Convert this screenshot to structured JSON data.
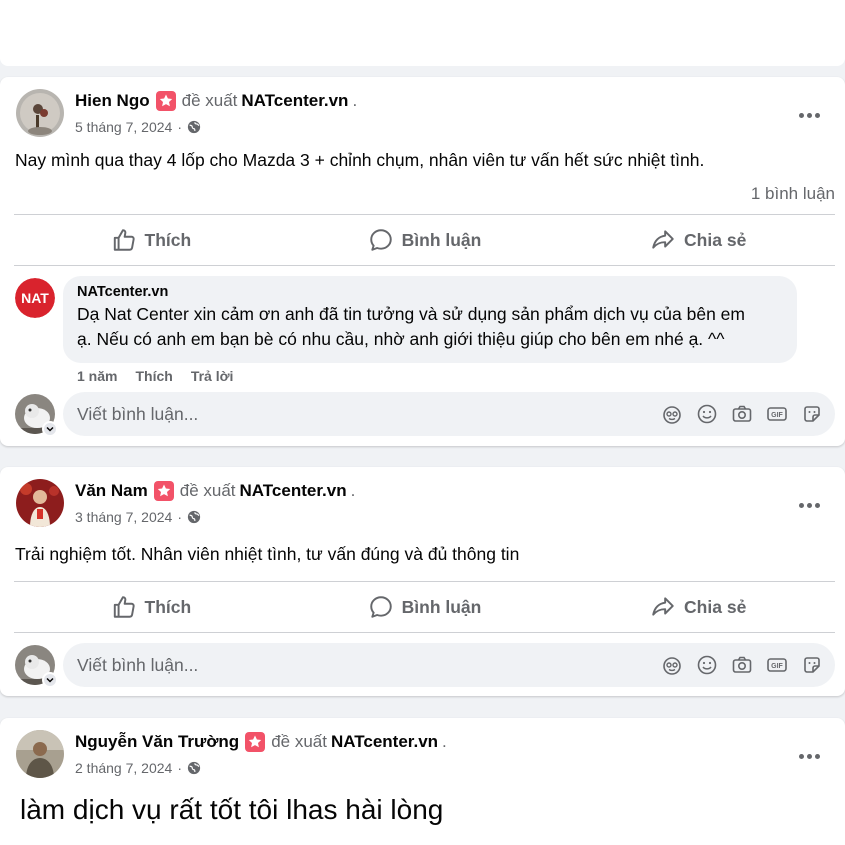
{
  "posts": [
    {
      "author": "Hien Ngo",
      "recommend_text": "đề xuất",
      "page": "NATcenter.vn",
      "date": "5 tháng 7, 2024",
      "separator": "·",
      "text": "Nay mình qua thay 4 lốp cho Mazda 3 + chỉnh chụm, nhân viên tư vấn hết sức nhiệt tình.",
      "comment_count": "1 bình luận",
      "comment": {
        "author": "NATcenter.vn",
        "avatar_text": "NAT",
        "body_line1": "Dạ Nat Center xin cảm ơn anh đã tin tưởng và sử dụng sản phẩm dịch vụ của bên em",
        "body_line2": "ạ. Nếu có anh em bạn bè có nhu cầu, nhờ anh giới thiệu giúp cho bên em nhé ạ. ^^",
        "time": "1 năm",
        "like": "Thích",
        "reply": "Trả lời"
      }
    },
    {
      "author": "Văn Nam",
      "recommend_text": "đề xuất",
      "page": "NATcenter.vn",
      "date": "3 tháng 7, 2024",
      "separator": "·",
      "text": "Trải nghiệm tốt. Nhân viên nhiệt tình, tư vấn đúng và đủ thông tin"
    },
    {
      "author": "Nguyễn Văn Trường",
      "recommend_text": "đề xuất",
      "page": "NATcenter.vn",
      "date": "2 tháng 7, 2024",
      "separator": "·",
      "text": "làm dịch vụ rất tốt tôi lhas hài lòng"
    }
  ],
  "actions": {
    "like": "Thích",
    "comment": "Bình luận",
    "share": "Chia sẻ"
  },
  "comment_input": {
    "placeholder": "Viết bình luận..."
  },
  "punctuation": ".",
  "colors": {
    "background": "#f0f2f5",
    "card": "#ffffff",
    "secondary_text": "#65676b",
    "recommend_badge": "#f25268",
    "nat_red": "#d9232d"
  },
  "icons": [
    "like-icon",
    "comment-icon",
    "share-icon",
    "globe-icon",
    "more-icon",
    "avatar-icon",
    "emoji-icon",
    "camera-icon",
    "gif-icon",
    "sticker-icon",
    "recommend-star-icon"
  ]
}
